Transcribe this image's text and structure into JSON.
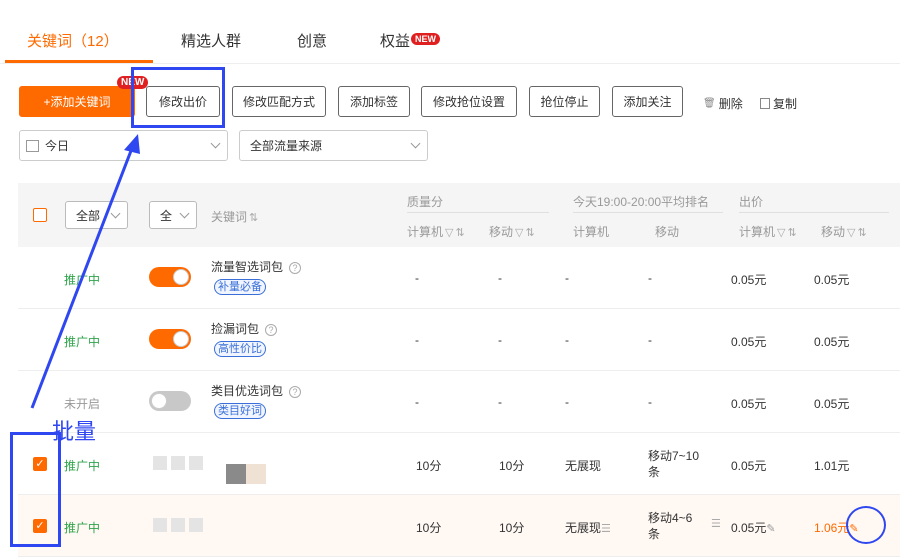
{
  "tabs": [
    {
      "label": "关键词（12）",
      "active": true
    },
    {
      "label": "精选人群",
      "active": false
    },
    {
      "label": "创意",
      "active": false
    },
    {
      "label": "权益",
      "active": false,
      "badge": "NEW"
    }
  ],
  "toolbar": {
    "add_keyword": "+添加关键词",
    "add_keyword_badge": "NEW",
    "modify_bid": "修改出价",
    "modify_match": "修改匹配方式",
    "add_tag": "添加标签",
    "modify_grab": "修改抢位设置",
    "grab_stop": "抢位停止",
    "add_follow": "添加关注",
    "delete": "删除",
    "copy": "复制"
  },
  "filters": {
    "date": "今日",
    "traffic_source": "全部流量来源"
  },
  "table_header": {
    "all_status": "全部",
    "all_toggle": "全",
    "keyword": "关键词",
    "quality": "质量分",
    "rank": "今天19:00-20:00平均排名",
    "bid": "出价",
    "pc": "计算机",
    "mobile": "移动",
    "sort_symbol": "⇅",
    "filter_symbol": "▽"
  },
  "rows": [
    {
      "checked": false,
      "status": "推广中",
      "status_on": true,
      "toggle_on": true,
      "keyword": "流量智选词包",
      "tag": "补量必备",
      "quality_pc": "-",
      "quality_mobile": "-",
      "rank_pc": "-",
      "rank_mobile": "-",
      "bid_pc": "0.05元",
      "bid_mobile": "0.05元"
    },
    {
      "checked": false,
      "status": "推广中",
      "status_on": true,
      "toggle_on": true,
      "keyword": "捡漏词包",
      "tag": "高性价比",
      "quality_pc": "-",
      "quality_mobile": "-",
      "rank_pc": "-",
      "rank_mobile": "-",
      "bid_pc": "0.05元",
      "bid_mobile": "0.05元"
    },
    {
      "checked": false,
      "status": "未开启",
      "status_on": false,
      "toggle_on": false,
      "keyword": "类目优选词包",
      "tag": "类目好词",
      "quality_pc": "-",
      "quality_mobile": "-",
      "rank_pc": "-",
      "rank_mobile": "-",
      "bid_pc": "0.05元",
      "bid_mobile": "0.05元"
    },
    {
      "checked": true,
      "status": "推广中",
      "status_on": true,
      "keyword": "",
      "quality_pc": "10分",
      "quality_mobile": "10分",
      "rank_pc": "无展现",
      "rank_mobile_1": "移动7~10",
      "rank_mobile_2": "条",
      "bid_pc": "0.05元",
      "bid_mobile": "1.01元"
    },
    {
      "checked": true,
      "status": "推广中",
      "status_on": true,
      "keyword": "",
      "quality_pc": "10分",
      "quality_mobile": "10分",
      "rank_pc": "无展现",
      "rank_mobile_1": "移动4~6",
      "rank_mobile_2": "条",
      "bid_pc": "0.05元",
      "bid_mobile": "1.06元"
    }
  ],
  "annotation": {
    "batch_label": "批量",
    "color": "#2f47f0"
  },
  "colors": {
    "accent": "#ff6a00",
    "status_green": "#2ea34a",
    "tag_blue": "#3a6fd8"
  }
}
